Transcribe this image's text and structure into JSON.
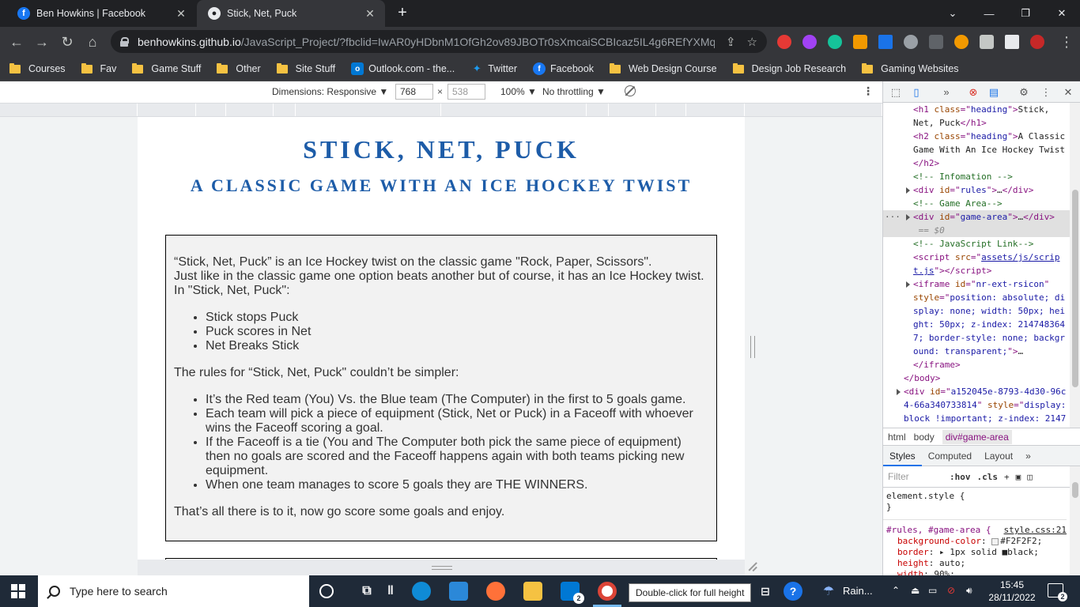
{
  "browser": {
    "tabs": [
      {
        "title": "Ben Howkins | Facebook",
        "icon": "facebook-icon",
        "active": false
      },
      {
        "title": "Stick, Net, Puck",
        "icon": "github-icon",
        "active": true
      }
    ],
    "url": {
      "host": "benhowkins.github.io",
      "path": "/JavaScript_Project/?fbclid=IwAR0yHDbnM1OfGh2ov89JBOTr0sXmcaiSCBIcaz5IL4g6REfYXMq_..."
    },
    "bookmarks": [
      {
        "label": "Courses",
        "type": "folder"
      },
      {
        "label": "Fav",
        "type": "folder"
      },
      {
        "label": "Game Stuff",
        "type": "folder"
      },
      {
        "label": "Other",
        "type": "folder"
      },
      {
        "label": "Site Stuff",
        "type": "folder"
      },
      {
        "label": "Outlook.com - the...",
        "type": "outlook"
      },
      {
        "label": "Twitter",
        "type": "twitter"
      },
      {
        "label": "Facebook",
        "type": "facebook"
      },
      {
        "label": "Web Design Course",
        "type": "folder"
      },
      {
        "label": "Design Job Research",
        "type": "folder"
      },
      {
        "label": "Gaming Websites",
        "type": "folder"
      }
    ]
  },
  "device_toolbar": {
    "dimensions_label": "Dimensions: Responsive ▼",
    "width": "768",
    "height": "538",
    "times": "×",
    "zoom": "100% ▼",
    "throttle": "No throttling ▼"
  },
  "page": {
    "title": "Stick, Net, Puck",
    "subtitle": "A Classic Game With An Ice Hockey Twist",
    "rules": {
      "intro": [
        "“Stick, Net, Puck” is an Ice Hockey twist on the classic game \"Rock, Paper, Scissors\".",
        "Just like in the classic game one option beats another but of course, it has an Ice Hockey twist.",
        "In \"Stick, Net, Puck\":"
      ],
      "beats": [
        "Stick stops Puck",
        "Puck scores in Net",
        "Net Breaks Stick"
      ],
      "rules_heading": "The rules for “Stick, Net, Puck\" couldn’t be simpler:",
      "list": [
        "It’s the Red team (You) Vs. the Blue team (The Computer) in the first to 5 goals game.",
        "Each team will pick a piece of equipment (Stick, Net or Puck) in a Faceoff with whoever wins the Faceoff scoring a goal.",
        "If the Faceoff is a tie (You and The Computer both pick the same piece of equipment) then no goals are scored and the Faceoff happens again with both teams picking new equipment.",
        "When one team manages to score 5 goals they are THE WINNERS."
      ],
      "closing": "That’s all there is to it, now go score some goals and enjoy."
    }
  },
  "devtools": {
    "elements": [
      {
        "indent": 1,
        "html": "<span class='tag'>&lt;h1 </span><span class='attr'>class</span><span class='tag'>=\"</span><span class='val'>heading</span><span class='tag'>\"&gt;</span><span class='text'>Stick,</span>"
      },
      {
        "indent": 1,
        "html": "<span class='text'>Net, Puck</span><span class='tag'>&lt;/h1&gt;</span>"
      },
      {
        "indent": 1,
        "html": "<span class='tag'>&lt;h2 </span><span class='attr'>class</span><span class='tag'>=\"</span><span class='val'>heading</span><span class='tag'>\"&gt;</span><span class='text'>A Classic</span>"
      },
      {
        "indent": 1,
        "html": "<span class='text'>Game With An Ice Hockey Twist</span>"
      },
      {
        "indent": 1,
        "html": "<span class='tag'>&lt;/h2&gt;</span>"
      },
      {
        "indent": 1,
        "html": "<span class='comment'>&lt;!-- Infomation --&gt;</span>"
      },
      {
        "indent": 1,
        "tri": true,
        "html": "<span class='tag'>&lt;div </span><span class='attr'>id</span><span class='tag'>=\"</span><span class='val'>rules</span><span class='tag'>\"&gt;</span><span class='text'>…</span><span class='tag'>&lt;/div&gt;</span>"
      },
      {
        "indent": 1,
        "html": "<span class='comment'>&lt;!-- Game Area--&gt;</span>"
      },
      {
        "indent": 1,
        "tri": true,
        "selected": true,
        "html": "<span class='tag'>&lt;div </span><span class='attr'>id</span><span class='tag'>=\"</span><span class='val'>game-area</span><span class='tag'>\"&gt;</span><span class='text'>…</span><span class='tag'>&lt;/div&gt;</span>"
      },
      {
        "indent": 1,
        "selected": true,
        "html": "<span class='eq'>&nbsp;== $0</span>"
      },
      {
        "indent": 1,
        "html": "<span class='comment'>&lt;!-- JavaScript Link--&gt;</span>"
      },
      {
        "indent": 1,
        "html": "<span class='tag'>&lt;script </span><span class='attr'>src</span><span class='tag'>=\"</span><span class='link'>assets/js/scrip</span>"
      },
      {
        "indent": 1,
        "html": "<span class='link'>t.js</span><span class='tag'>\"&gt;&lt;/script&gt;</span>"
      },
      {
        "indent": 1,
        "tri": true,
        "html": "<span class='tag'>&lt;iframe </span><span class='attr'>id</span><span class='tag'>=\"</span><span class='val'>nr-ext-rsicon</span><span class='tag'>\"</span>"
      },
      {
        "indent": 1,
        "html": "<span class='attr'>style</span><span class='tag'>=\"</span><span class='val'>position: absolute; di</span>"
      },
      {
        "indent": 1,
        "html": "<span class='val'>splay: none; width: 50px; hei</span>"
      },
      {
        "indent": 1,
        "html": "<span class='val'>ght: 50px; z-index: 214748364</span>"
      },
      {
        "indent": 1,
        "html": "<span class='val'>7; border-style: none; backgr</span>"
      },
      {
        "indent": 1,
        "html": "<span class='val'>ound: transparent;</span><span class='tag'>\"&gt;</span><span class='text'>…</span>"
      },
      {
        "indent": 1,
        "html": "<span class='tag'>&lt;/iframe&gt;</span>"
      },
      {
        "indent": 0,
        "html": "<span class='tag'>&lt;/body&gt;</span>"
      },
      {
        "indent": 0,
        "tri": true,
        "html": "<span class='tag'>&lt;div </span><span class='attr'>id</span><span class='tag'>=\"</span><span class='val'>a152045e-8793-4d30-96c</span>"
      },
      {
        "indent": 0,
        "html": "<span class='val'>4-66a340733814</span><span class='tag'>\" </span><span class='attr'>style</span><span class='tag'>=\"</span><span class='val'>display:</span>"
      },
      {
        "indent": 0,
        "html": "<span class='val'>block !important; z-index: 2147</span>"
      },
      {
        "indent": 0,
        "html": "<span class='val'>483647 !important;</span><span class='tag'>\"&gt;</span><span class='text'>…</span><span class='tag'>&lt;/div&gt;</span>"
      }
    ],
    "breadcrumb": [
      "html",
      "body",
      "div#game-area"
    ],
    "tabs": [
      "Styles",
      "Computed",
      "Layout",
      "»"
    ],
    "filter_placeholder": "Filter",
    "hov": ":hov",
    "cls": ".cls",
    "styles": {
      "element_style_open": "element.style {",
      "element_style_close": "}",
      "rule_selector": "#rules, #game-area {",
      "rule_source": "style.css:21",
      "props": [
        {
          "name": "background-color",
          "value": "#F2F2F2;",
          "swatch": "#F2F2F2"
        },
        {
          "name": "border",
          "value": "▸ 1px solid ■black;"
        },
        {
          "name": "height",
          "value": "auto;"
        },
        {
          "name": "width",
          "value": "90%;"
        }
      ]
    }
  },
  "taskbar": {
    "search_placeholder": "Type here to search",
    "tooltip": "Double-click for full height",
    "weather": "Rain...",
    "time": "15:45",
    "date": "28/11/2022",
    "mail_badge": "2",
    "notif_badge": "2"
  },
  "colors": {
    "heading": "#1d5ca8",
    "rules_bg": "#F2F2F2",
    "chrome_dark": "#202124"
  }
}
